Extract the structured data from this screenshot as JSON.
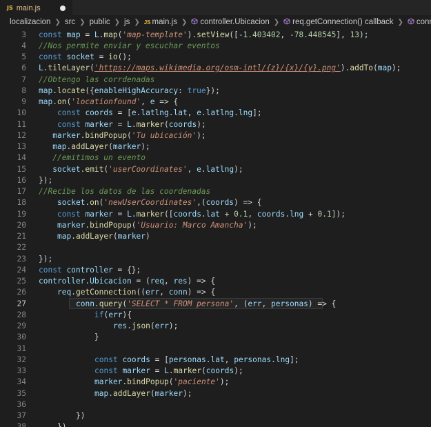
{
  "tab": {
    "badge": "JS",
    "filename": "main.js"
  },
  "breadcrumb": {
    "items": [
      "localizacion",
      "src",
      "public",
      "js",
      "main.js",
      "controller.Ubicacion",
      "req.getConnection() callback",
      "conn.query('SELE"
    ],
    "js_badge": "JS"
  },
  "colors": {
    "background": "#1e1e1e",
    "tab_filename": "#e2c08d",
    "keyword": "#569cd6",
    "string": "#ce9178",
    "comment": "#6a9955",
    "number": "#b5cea8"
  },
  "code_lines": [
    {
      "n": "3",
      "text": "const map = L.map('map-template').setView([-1.403402, -78.448545], 13);"
    },
    {
      "n": "4",
      "text": "//Nos permite enviar y escuchar eventos"
    },
    {
      "n": "5",
      "text": "const socket = io();"
    },
    {
      "n": "6",
      "text": "L.tileLayer('https://maps.wikimedia.org/osm-intl/{z}/{x}/{y}.png').addTo(map);"
    },
    {
      "n": "7",
      "text": "//Obtengo las corrdenadas"
    },
    {
      "n": "8",
      "text": "map.locate({enableHighAccuracy: true});"
    },
    {
      "n": "9",
      "text": "map.on('locationfound', e => {"
    },
    {
      "n": "10",
      "text": "    const coords = [e.latlng.lat, e.latlng.lng];"
    },
    {
      "n": "11",
      "text": "    const marker = L.marker(coords);"
    },
    {
      "n": "12",
      "text": "   marker.bindPopup('Tu ubicación');"
    },
    {
      "n": "13",
      "text": "   map.addLayer(marker);"
    },
    {
      "n": "14",
      "text": "   //emitimos un evento"
    },
    {
      "n": "15",
      "text": "   socket.emit('userCoordinates', e.latlng);"
    },
    {
      "n": "16",
      "text": "});"
    },
    {
      "n": "17",
      "text": "//Recibe los datos de las coordenadas"
    },
    {
      "n": "18",
      "text": "    socket.on('newUserCoordinates',(coords) => {"
    },
    {
      "n": "19",
      "text": "    const marker = L.marker([coords.lat + 0.1, coords.lng + 0.1]);"
    },
    {
      "n": "20",
      "text": "    marker.bindPopup('Usuario: Marco Amancha');"
    },
    {
      "n": "21",
      "text": "    map.addLayer(marker)"
    },
    {
      "n": "22",
      "text": ""
    },
    {
      "n": "23",
      "text": "});"
    },
    {
      "n": "24",
      "text": "const controller = {};"
    },
    {
      "n": "25",
      "text": "controller.Ubicacion = (req, res) => {"
    },
    {
      "n": "26",
      "text": "    req.getConnection((err, conn) => {"
    },
    {
      "n": "27",
      "text": "        conn.query('SELECT * FROM persona', (err, personas) => {"
    },
    {
      "n": "28",
      "text": "            if(err){"
    },
    {
      "n": "29",
      "text": "                res.json(err);"
    },
    {
      "n": "30",
      "text": "            }"
    },
    {
      "n": "31",
      "text": ""
    },
    {
      "n": "32",
      "text": "            const coords = [personas.lat, personas.lng];"
    },
    {
      "n": "33",
      "text": "            const marker = L.marker(coords);"
    },
    {
      "n": "34",
      "text": "            marker.bindPopup('paciente');"
    },
    {
      "n": "35",
      "text": "            map.addLayer(marker);"
    },
    {
      "n": "36",
      "text": ""
    },
    {
      "n": "37",
      "text": "        })"
    },
    {
      "n": "38",
      "text": "    })"
    }
  ],
  "active_line": "27"
}
